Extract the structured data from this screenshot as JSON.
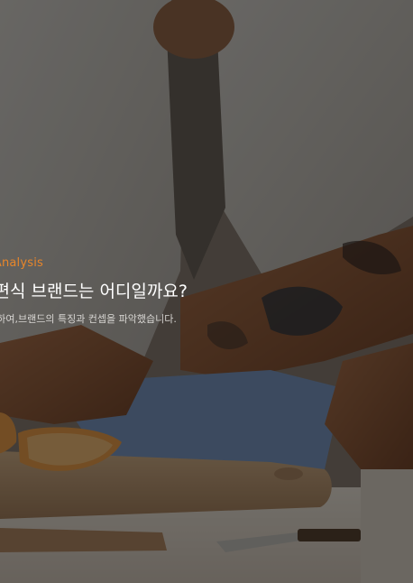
{
  "section": {
    "eyebrow": "rs Analysis",
    "headline": "간편식 브랜드는 어디일까요?",
    "description": "분석하여,브랜드의 특징과 컨셉을 파악했습니다."
  },
  "colors": {
    "accent": "#e8862a",
    "overlay": "#000000"
  },
  "background": {
    "icon": "cooking-hands-photo"
  }
}
